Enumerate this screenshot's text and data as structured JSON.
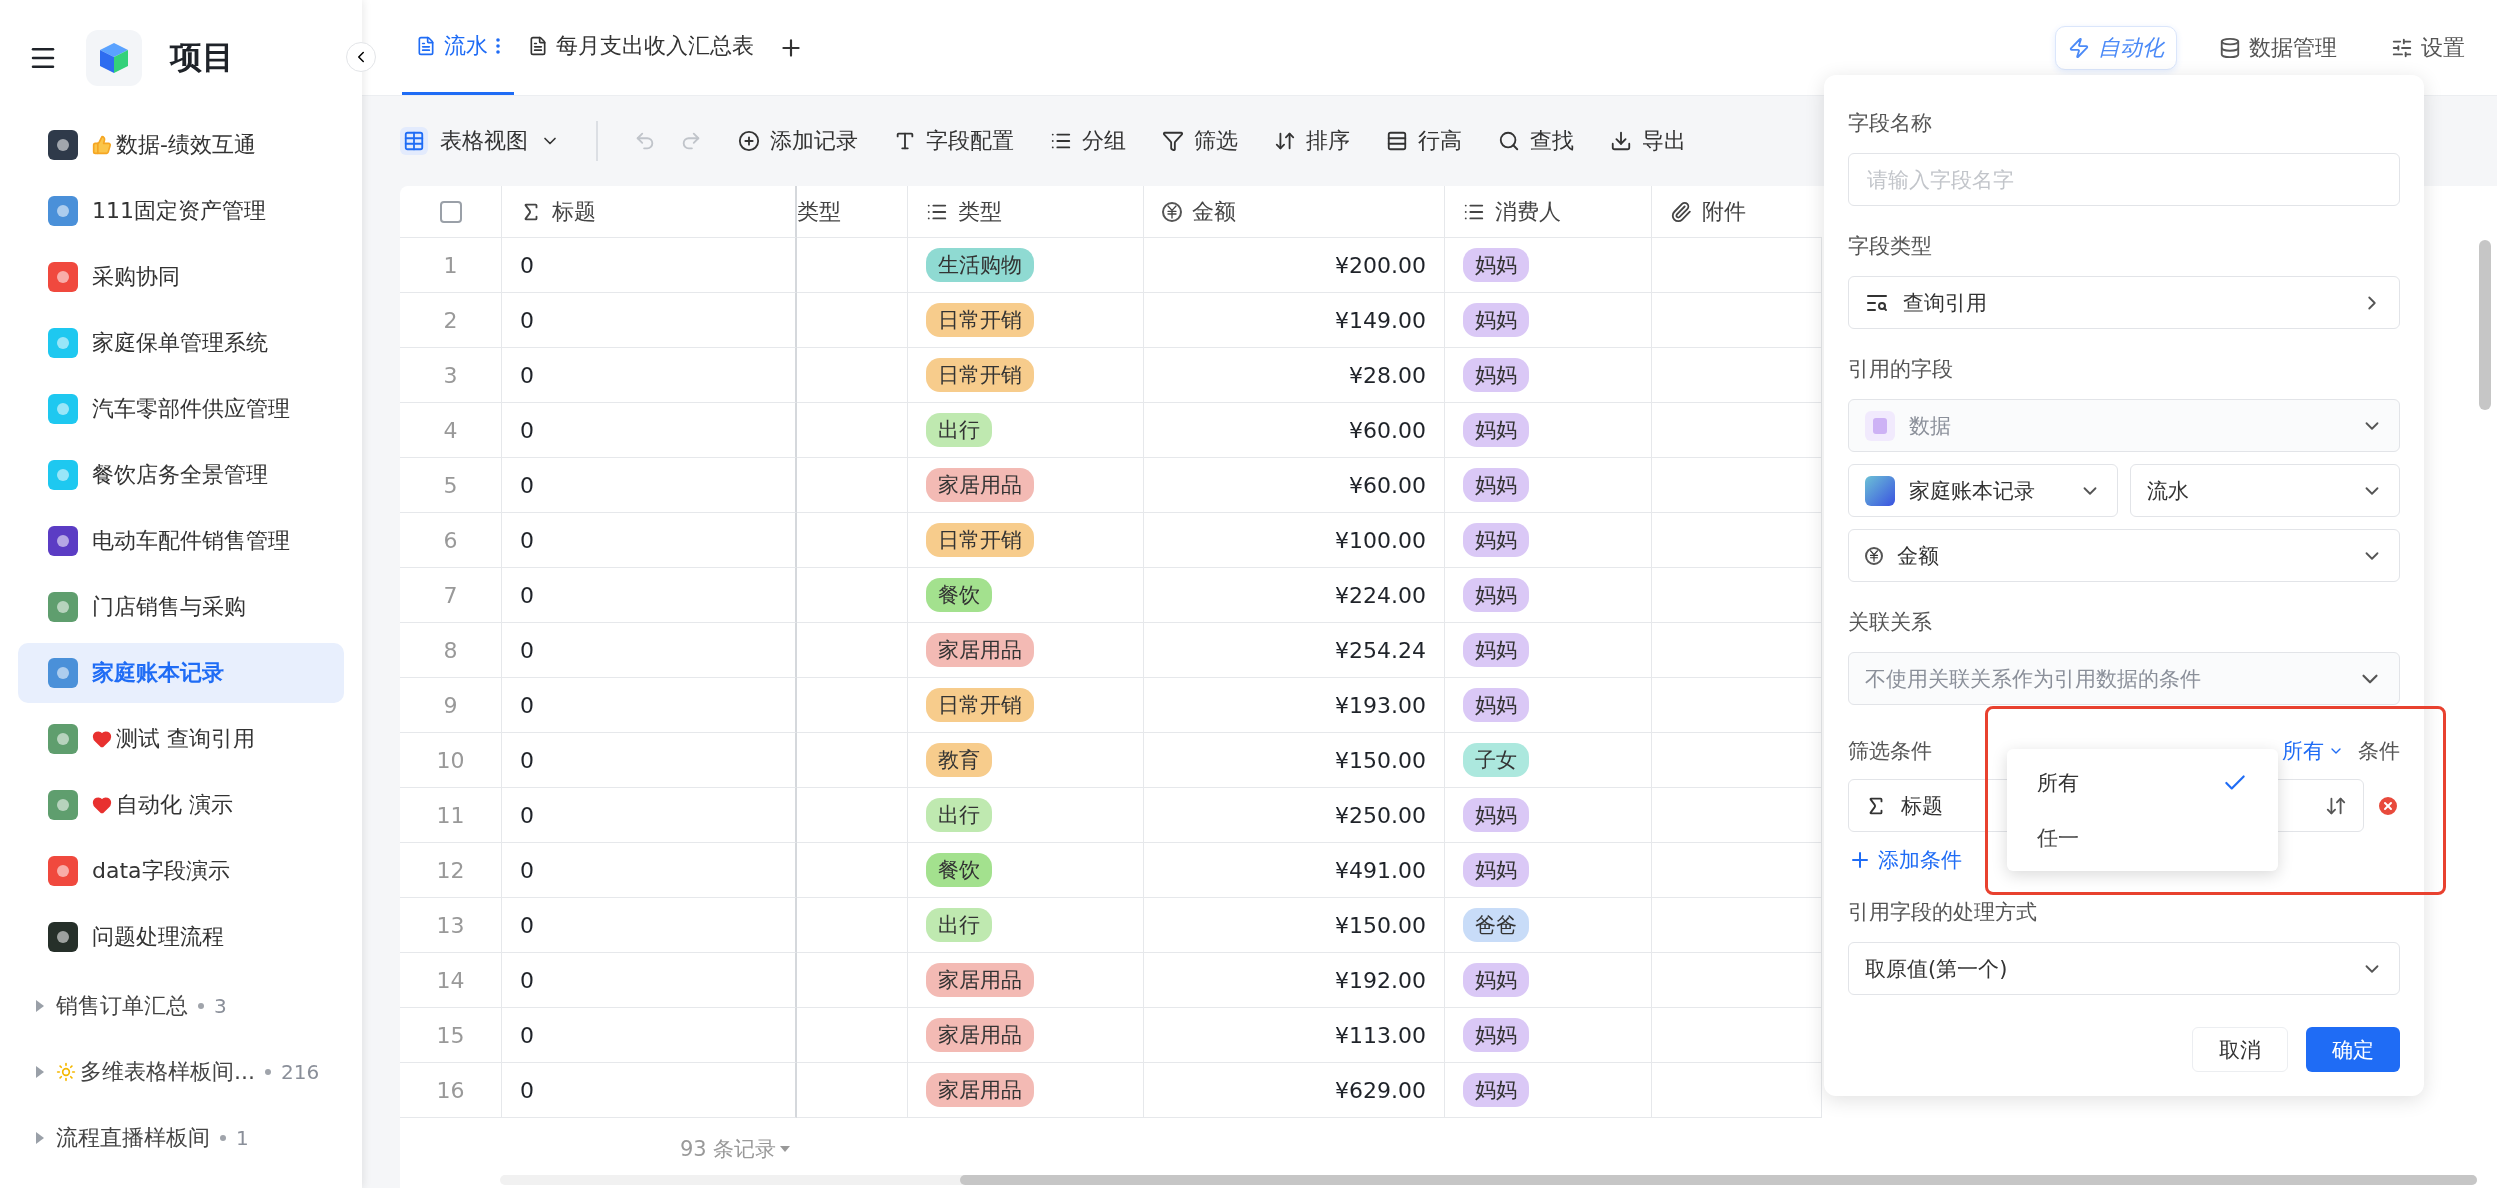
{
  "app": {
    "title": "项目"
  },
  "sidebar": {
    "items": [
      {
        "label": "数据-绩效互通",
        "kind": "thumb",
        "color": "#2f3a4a",
        "selected": false
      },
      {
        "label": "111固定资产管理",
        "color": "#4a90d9",
        "selected": false
      },
      {
        "label": "采购协同",
        "color": "#f0493e",
        "selected": false
      },
      {
        "label": "家庭保单管理系统",
        "color": "#1ec8f0",
        "selected": false
      },
      {
        "label": "汽车零部件供应管理",
        "color": "#1ec8f0",
        "selected": false
      },
      {
        "label": "餐饮店务全景管理",
        "color": "#1ec8f0",
        "selected": false
      },
      {
        "label": "电动车配件销售管理",
        "color": "#5b3cc4",
        "selected": false
      },
      {
        "label": "门店销售与采购",
        "color": "#5f9e6e",
        "selected": false
      },
      {
        "label": "家庭账本记录",
        "color": "#4a90d9",
        "selected": true
      },
      {
        "label": "测试 查询引用",
        "kind": "heart",
        "color": "#5f9e6e",
        "selected": false
      },
      {
        "label": "自动化 演示",
        "kind": "heart",
        "color": "#5f9e6e",
        "selected": false
      },
      {
        "label": "data字段演示",
        "color": "#f0493e",
        "selected": false
      },
      {
        "label": "问题处理流程",
        "color": "#26302a",
        "selected": false
      }
    ],
    "groups": [
      {
        "label": "销售订单汇总",
        "count": "3",
        "kind": "plain",
        "expanded": false
      },
      {
        "label": "多维表格样板间...",
        "count": "216",
        "kind": "sun",
        "expanded": false
      },
      {
        "label": "流程直播样板间",
        "count": "1",
        "kind": "plain",
        "expanded": false
      }
    ]
  },
  "tabs": [
    {
      "label": "流水",
      "selected": true
    },
    {
      "label": "每月支出收入汇总表",
      "selected": false
    }
  ],
  "header_actions": [
    {
      "label": "自动化",
      "kind": "automation"
    },
    {
      "label": "数据管理",
      "kind": "data"
    },
    {
      "label": "设置",
      "kind": "settings"
    }
  ],
  "toolbar": {
    "view": "表格视图",
    "items": [
      {
        "label": "添加记录",
        "kind": "add"
      },
      {
        "label": "字段配置",
        "kind": "field"
      },
      {
        "label": "分组",
        "kind": "group"
      },
      {
        "label": "筛选",
        "kind": "filter"
      },
      {
        "label": "排序",
        "kind": "sort"
      },
      {
        "label": "行高",
        "kind": "height"
      },
      {
        "label": "查找",
        "kind": "search"
      },
      {
        "label": "导出",
        "kind": "export"
      }
    ]
  },
  "table": {
    "select_all_checked": false,
    "columns": [
      {
        "label": "标题",
        "kind": "sigma"
      },
      {
        "label": "类型",
        "kind": "none"
      },
      {
        "label": "类型",
        "kind": "list"
      },
      {
        "label": "金额",
        "kind": "money"
      },
      {
        "label": "消费人",
        "kind": "list"
      },
      {
        "label": "附件",
        "kind": "clip"
      }
    ],
    "rows": [
      {
        "num": "1",
        "title": "0",
        "type": {
          "label": "生活购物",
          "color": "#8fdad2"
        },
        "amount": "¥200.00",
        "consumer": {
          "label": "妈妈",
          "color": "#dac8f6"
        }
      },
      {
        "num": "2",
        "title": "0",
        "type": {
          "label": "日常开销",
          "color": "#f7cc8c"
        },
        "amount": "¥149.00",
        "consumer": {
          "label": "妈妈",
          "color": "#dac8f6"
        }
      },
      {
        "num": "3",
        "title": "0",
        "type": {
          "label": "日常开销",
          "color": "#f7cc8c"
        },
        "amount": "¥28.00",
        "consumer": {
          "label": "妈妈",
          "color": "#dac8f6"
        }
      },
      {
        "num": "4",
        "title": "0",
        "type": {
          "label": "出行",
          "color": "#bfe9b0"
        },
        "amount": "¥60.00",
        "consumer": {
          "label": "妈妈",
          "color": "#dac8f6"
        }
      },
      {
        "num": "5",
        "title": "0",
        "type": {
          "label": "家居用品",
          "color": "#f3bab4"
        },
        "amount": "¥60.00",
        "consumer": {
          "label": "妈妈",
          "color": "#dac8f6"
        }
      },
      {
        "num": "6",
        "title": "0",
        "type": {
          "label": "日常开销",
          "color": "#f7cc8c"
        },
        "amount": "¥100.00",
        "consumer": {
          "label": "妈妈",
          "color": "#dac8f6"
        }
      },
      {
        "num": "7",
        "title": "0",
        "type": {
          "label": "餐饮",
          "color": "#a3e18e"
        },
        "amount": "¥224.00",
        "consumer": {
          "label": "妈妈",
          "color": "#dac8f6"
        }
      },
      {
        "num": "8",
        "title": "0",
        "type": {
          "label": "家居用品",
          "color": "#f3bab4"
        },
        "amount": "¥254.24",
        "consumer": {
          "label": "妈妈",
          "color": "#dac8f6"
        }
      },
      {
        "num": "9",
        "title": "0",
        "type": {
          "label": "日常开销",
          "color": "#f7cc8c"
        },
        "amount": "¥193.00",
        "consumer": {
          "label": "妈妈",
          "color": "#dac8f6"
        }
      },
      {
        "num": "10",
        "title": "0",
        "type": {
          "label": "教育",
          "color": "#f7cc8c"
        },
        "amount": "¥150.00",
        "consumer": {
          "label": "子女",
          "color": "#ace8de"
        }
      },
      {
        "num": "11",
        "title": "0",
        "type": {
          "label": "出行",
          "color": "#bfe9b0"
        },
        "amount": "¥250.00",
        "consumer": {
          "label": "妈妈",
          "color": "#dac8f6"
        }
      },
      {
        "num": "12",
        "title": "0",
        "type": {
          "label": "餐饮",
          "color": "#a3e18e"
        },
        "amount": "¥491.00",
        "consumer": {
          "label": "妈妈",
          "color": "#dac8f6"
        }
      },
      {
        "num": "13",
        "title": "0",
        "type": {
          "label": "出行",
          "color": "#bfe9b0"
        },
        "amount": "¥150.00",
        "consumer": {
          "label": "爸爸",
          "color": "#c8dcf8"
        }
      },
      {
        "num": "14",
        "title": "0",
        "type": {
          "label": "家居用品",
          "color": "#f3bab4"
        },
        "amount": "¥192.00",
        "consumer": {
          "label": "妈妈",
          "color": "#dac8f6"
        }
      },
      {
        "num": "15",
        "title": "0",
        "type": {
          "label": "家居用品",
          "color": "#f3bab4"
        },
        "amount": "¥113.00",
        "consumer": {
          "label": "妈妈",
          "color": "#dac8f6"
        }
      },
      {
        "num": "16",
        "title": "0",
        "type": {
          "label": "家居用品",
          "color": "#f3bab4"
        },
        "amount": "¥629.00",
        "consumer": {
          "label": "妈妈",
          "color": "#dac8f6"
        }
      }
    ],
    "footer": "93 条记录"
  },
  "panel": {
    "name_label": "字段名称",
    "name_placeholder": "请输入字段名字",
    "type_label": "字段类型",
    "type_value": "查询引用",
    "ref_label": "引用的字段",
    "ref_source": "数据",
    "ref_table": "家庭账本记录",
    "ref_sheet": "流水",
    "ref_field": "金额",
    "relation_label": "关联关系",
    "relation_value": "不使用关联关系作为引用数据的条件",
    "filter_label": "筛选条件",
    "filter_match": "所有",
    "filter_suffix": "条件",
    "condition_field": "标题",
    "add_condition": "添加条件",
    "mode_label": "引用字段的处理方式",
    "mode_value": "取原值(第一个)",
    "buttons": [
      {
        "label": "取消",
        "kind": "secondary"
      },
      {
        "label": "确定",
        "kind": "primary"
      }
    ],
    "match_menu": [
      {
        "label": "所有",
        "selected": true
      },
      {
        "label": "任一",
        "selected": false
      }
    ]
  }
}
